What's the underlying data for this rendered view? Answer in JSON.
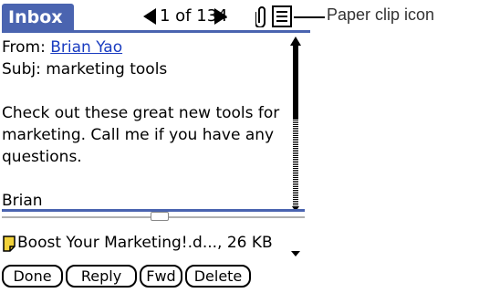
{
  "title": {
    "label": "Inbox",
    "counter": "1 of 134",
    "callout": "Paper clip icon"
  },
  "icons": {
    "prev": "left-arrow-icon",
    "next": "right-arrow-icon",
    "clip": "paper-clip-icon",
    "list": "list-icon",
    "attachment": "note-icon"
  },
  "colors": {
    "accent": "#4a64b0",
    "link": "#1a3cc0",
    "attachment_icon": "#f2d23a"
  },
  "message": {
    "from_label": "From:",
    "from_name": "Brian Yao",
    "subject_line": "Subj: marketing tools",
    "body_lines": [
      "Check out these great new tools for",
      "marketing. Call me if you have any",
      "questions."
    ],
    "signature": "Brian"
  },
  "attachment": {
    "label": "Boost Your Marketing!.d..., 26 KB"
  },
  "buttons": {
    "done": "Done",
    "reply": "Reply",
    "fwd": "Fwd",
    "delete": "Delete"
  }
}
